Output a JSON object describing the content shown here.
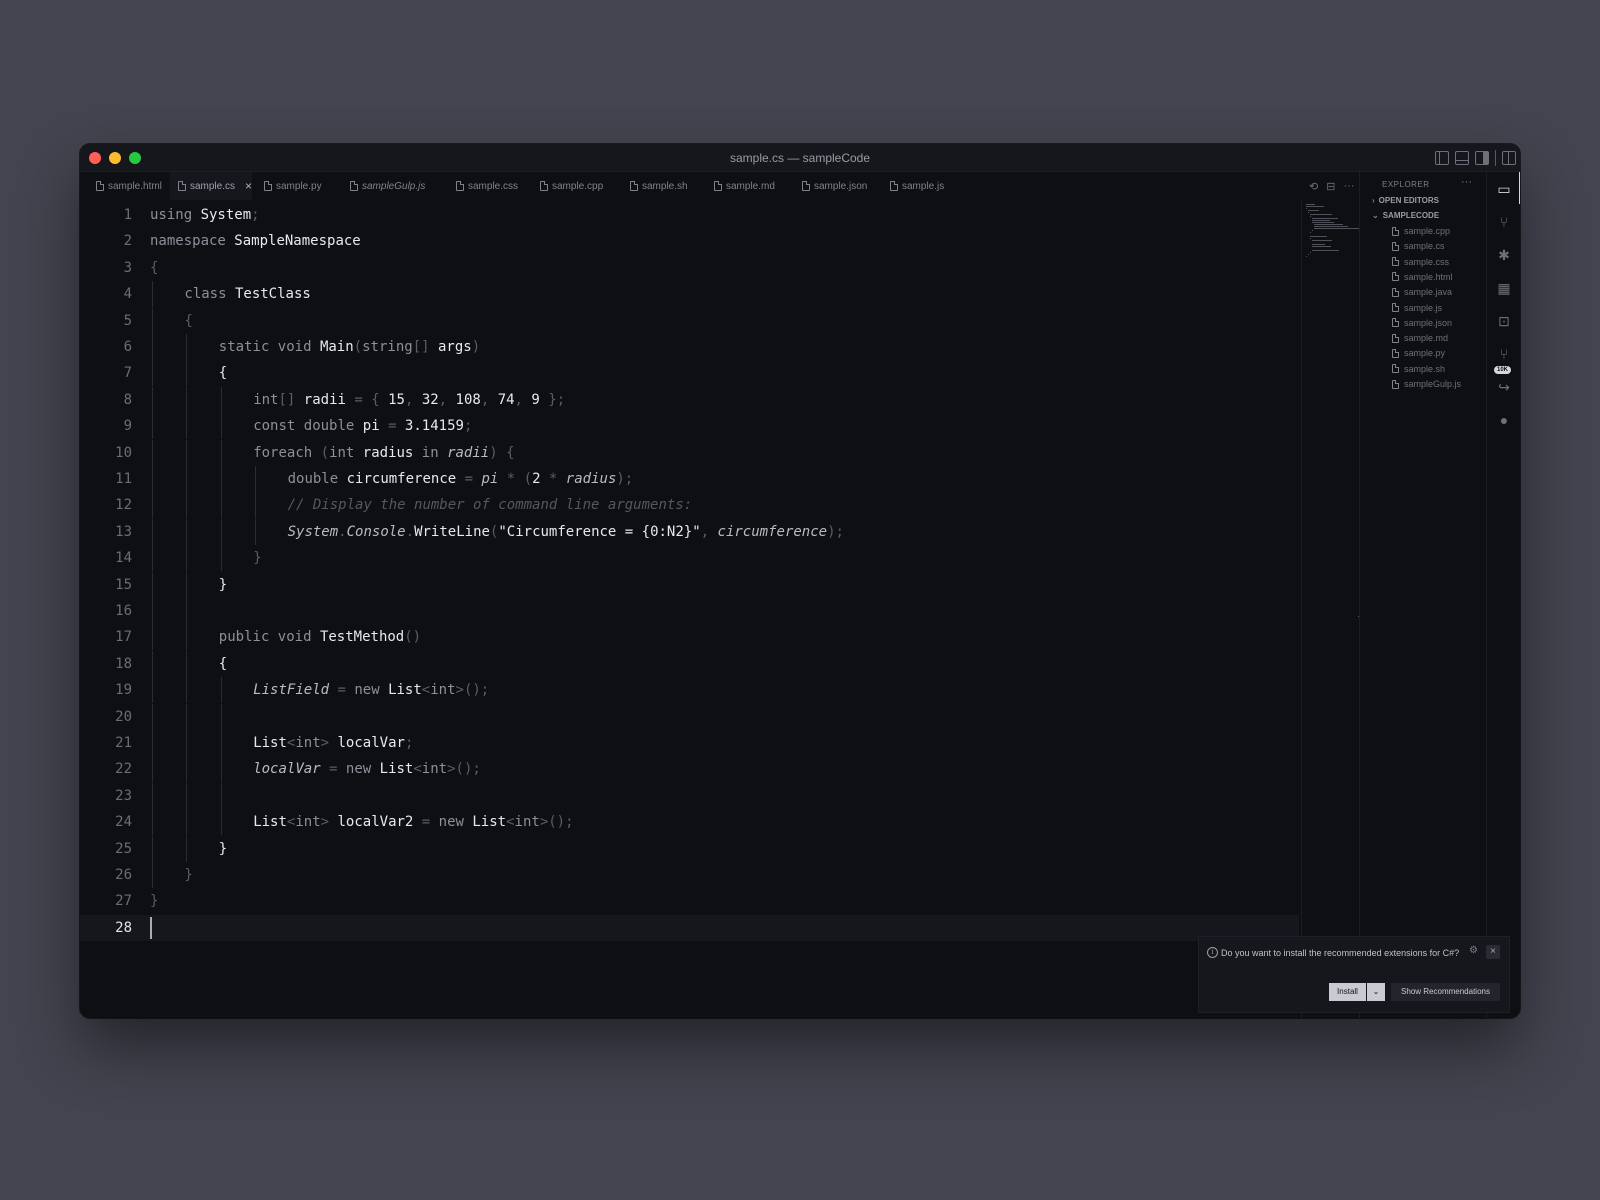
{
  "window": {
    "title": "sample.cs — sampleCode"
  },
  "tabs": [
    {
      "label": "sample.html"
    },
    {
      "label": "sample.cs"
    },
    {
      "label": "sample.py"
    },
    {
      "label": "sampleGulp.js"
    },
    {
      "label": "sample.css"
    },
    {
      "label": "sample.cpp"
    },
    {
      "label": "sample.sh"
    },
    {
      "label": "sample.md"
    },
    {
      "label": "sample.json"
    },
    {
      "label": "sample.js"
    }
  ],
  "active_tab": "sample.cs",
  "editor": {
    "current_line": 28,
    "lines": [
      {
        "n": "1",
        "indent": 0,
        "tokens": [
          [
            "kw",
            "using "
          ],
          [
            "id",
            "System"
          ],
          [
            "p",
            ";"
          ]
        ]
      },
      {
        "n": "2",
        "indent": 0,
        "tokens": [
          [
            "kw",
            "namespace "
          ],
          [
            "id",
            "SampleNamespace"
          ]
        ]
      },
      {
        "n": "3",
        "indent": 0,
        "tokens": [
          [
            "p",
            "{"
          ]
        ]
      },
      {
        "n": "4",
        "indent": 1,
        "tokens": [
          [
            "kw",
            "class "
          ],
          [
            "id",
            "TestClass"
          ]
        ]
      },
      {
        "n": "5",
        "indent": 1,
        "tokens": [
          [
            "p",
            "{"
          ]
        ]
      },
      {
        "n": "6",
        "indent": 2,
        "tokens": [
          [
            "kw",
            "static void "
          ],
          [
            "id",
            "Main"
          ],
          [
            "p",
            "("
          ],
          [
            "kw",
            "string"
          ],
          [
            "p",
            "[] "
          ],
          [
            "id",
            "args"
          ],
          [
            "p",
            ")"
          ]
        ]
      },
      {
        "n": "7",
        "indent": 2,
        "tokens": [
          [
            "id",
            "{"
          ]
        ]
      },
      {
        "n": "8",
        "indent": 3,
        "tokens": [
          [
            "kw",
            "int"
          ],
          [
            "p",
            "[] "
          ],
          [
            "id",
            "radii"
          ],
          [
            "p",
            " = { "
          ],
          [
            "num",
            "15"
          ],
          [
            "p",
            ", "
          ],
          [
            "num",
            "32"
          ],
          [
            "p",
            ", "
          ],
          [
            "num",
            "108"
          ],
          [
            "p",
            ", "
          ],
          [
            "num",
            "74"
          ],
          [
            "p",
            ", "
          ],
          [
            "num",
            "9"
          ],
          [
            "p",
            " };"
          ]
        ]
      },
      {
        "n": "9",
        "indent": 3,
        "tokens": [
          [
            "kw",
            "const double "
          ],
          [
            "id",
            "pi"
          ],
          [
            "p",
            " = "
          ],
          [
            "num",
            "3.14159"
          ],
          [
            "p",
            ";"
          ]
        ]
      },
      {
        "n": "10",
        "indent": 3,
        "tokens": [
          [
            "kw",
            "foreach "
          ],
          [
            "p",
            "("
          ],
          [
            "kw",
            "int "
          ],
          [
            "id",
            "radius"
          ],
          [
            "kw",
            " in "
          ],
          [
            "it",
            "radii"
          ],
          [
            "p",
            ") {"
          ]
        ]
      },
      {
        "n": "11",
        "indent": 4,
        "tokens": [
          [
            "kw",
            "double "
          ],
          [
            "id",
            "circumference"
          ],
          [
            "p",
            " = "
          ],
          [
            "it",
            "pi"
          ],
          [
            "p",
            " * ("
          ],
          [
            "num",
            "2"
          ],
          [
            "p",
            " * "
          ],
          [
            "it",
            "radius"
          ],
          [
            "p",
            ");"
          ]
        ]
      },
      {
        "n": "12",
        "indent": 4,
        "tokens": [
          [
            "cm",
            "// Display the number of command line arguments:"
          ]
        ]
      },
      {
        "n": "13",
        "indent": 4,
        "tokens": [
          [
            "it",
            "System"
          ],
          [
            "p",
            "."
          ],
          [
            "it",
            "Console"
          ],
          [
            "p",
            "."
          ],
          [
            "id",
            "WriteLine"
          ],
          [
            "p",
            "("
          ],
          [
            "str",
            "\"Circumference = {0:N2}\""
          ],
          [
            "p",
            ", "
          ],
          [
            "it",
            "circumference"
          ],
          [
            "p",
            ");"
          ]
        ]
      },
      {
        "n": "14",
        "indent": 3,
        "tokens": [
          [
            "p",
            "}"
          ]
        ]
      },
      {
        "n": "15",
        "indent": 2,
        "tokens": [
          [
            "id",
            "}"
          ]
        ]
      },
      {
        "n": "16",
        "indent": 0,
        "tokens": []
      },
      {
        "n": "17",
        "indent": 2,
        "tokens": [
          [
            "kw",
            "public void "
          ],
          [
            "id",
            "TestMethod"
          ],
          [
            "p",
            "()"
          ]
        ]
      },
      {
        "n": "18",
        "indent": 2,
        "tokens": [
          [
            "id",
            "{"
          ]
        ]
      },
      {
        "n": "19",
        "indent": 3,
        "tokens": [
          [
            "it",
            "ListField"
          ],
          [
            "p",
            " = "
          ],
          [
            "kw",
            "new "
          ],
          [
            "id",
            "List"
          ],
          [
            "p",
            "<"
          ],
          [
            "kw",
            "int"
          ],
          [
            "p",
            ">();"
          ]
        ]
      },
      {
        "n": "20",
        "indent": 0,
        "tokens": []
      },
      {
        "n": "21",
        "indent": 3,
        "tokens": [
          [
            "id",
            "List"
          ],
          [
            "p",
            "<"
          ],
          [
            "kw",
            "int"
          ],
          [
            "p",
            "> "
          ],
          [
            "id",
            "localVar"
          ],
          [
            "p",
            ";"
          ]
        ]
      },
      {
        "n": "22",
        "indent": 3,
        "tokens": [
          [
            "it",
            "localVar"
          ],
          [
            "p",
            " = "
          ],
          [
            "kw",
            "new "
          ],
          [
            "id",
            "List"
          ],
          [
            "p",
            "<"
          ],
          [
            "kw",
            "int"
          ],
          [
            "p",
            ">();"
          ]
        ]
      },
      {
        "n": "23",
        "indent": 0,
        "tokens": []
      },
      {
        "n": "24",
        "indent": 3,
        "tokens": [
          [
            "id",
            "List"
          ],
          [
            "p",
            "<"
          ],
          [
            "kw",
            "int"
          ],
          [
            "p",
            "> "
          ],
          [
            "id",
            "localVar2"
          ],
          [
            "p",
            " = "
          ],
          [
            "kw",
            "new "
          ],
          [
            "id",
            "List"
          ],
          [
            "p",
            "<"
          ],
          [
            "kw",
            "int"
          ],
          [
            "p",
            ">();"
          ]
        ]
      },
      {
        "n": "25",
        "indent": 2,
        "tokens": [
          [
            "id",
            "}"
          ]
        ]
      },
      {
        "n": "26",
        "indent": 1,
        "tokens": [
          [
            "p",
            "}"
          ]
        ]
      },
      {
        "n": "27",
        "indent": 0,
        "tokens": [
          [
            "p",
            "}"
          ]
        ]
      },
      {
        "n": "28",
        "indent": 0,
        "tokens": []
      }
    ]
  },
  "explorer": {
    "title": "EXPLORER",
    "more": "···",
    "open_editors": "OPEN EDITORS",
    "folder": "SAMPLECODE",
    "files": [
      "sample.cpp",
      "sample.cs",
      "sample.css",
      "sample.html",
      "sample.java",
      "sample.js",
      "sample.json",
      "sample.md",
      "sample.py",
      "sample.sh",
      "sampleGulp.js"
    ]
  },
  "activity": {
    "badge": "10K",
    "icons": [
      "files-icon",
      "source-control-icon",
      "debug-icon",
      "extensions-icon",
      "remote-explorer-icon",
      "git-graph-icon",
      "live-share-icon",
      "github-icon"
    ]
  },
  "notification": {
    "message": "Do you want to install the recommended extensions for C#?",
    "install": "Install",
    "install_dropdown": "⌄",
    "show_recommendations": "Show Recommendations",
    "close": "×",
    "gear": "⚙",
    "info": "i"
  },
  "editor_actions": {
    "history": "⟲",
    "split": "⊟",
    "more": "···"
  },
  "colors": {
    "background": "#43444f",
    "editor_bg": "#0e0f13",
    "panel_bg": "#16171c"
  }
}
